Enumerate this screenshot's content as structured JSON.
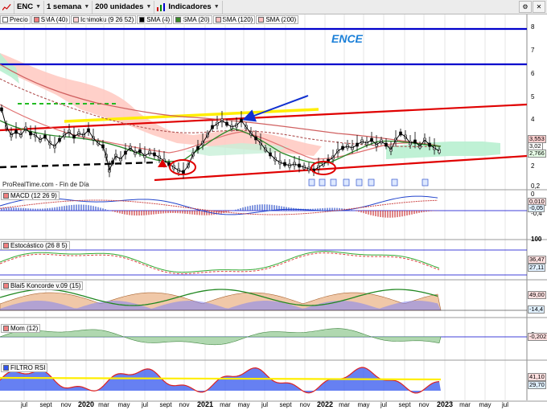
{
  "toolbar": {
    "ticker": "ENC",
    "period": "1 semana",
    "units": "200 unidades",
    "indicators": "Indicadores",
    "arrow": "▼"
  },
  "price_legend": [
    {
      "label": "Precio",
      "color": "#ffffff"
    },
    {
      "label": "SMA (40)",
      "color": "#f08080"
    },
    {
      "label": "Ichimoku (9 26 52)",
      "color": "#ffd0d0"
    },
    {
      "label": "SMA (4)",
      "color": "#000000"
    },
    {
      "label": "SMA (20)",
      "color": "#3a8a2a"
    },
    {
      "label": "SMA (120)",
      "color": "#ffc0c0"
    },
    {
      "label": "SMA (200)",
      "color": "#ffc0c0"
    }
  ],
  "annotation_title": "ENCE",
  "source_text": "ProRealTime.com - Fin de Día",
  "price_axis": [
    "8",
    "7",
    "6",
    "5",
    "4",
    "3",
    "2"
  ],
  "price_boxes": [
    "3,553",
    "3,02",
    "2,766"
  ],
  "panels": {
    "macd": {
      "label": "MACD (12 26 9)",
      "axis": [
        "0,2",
        "0",
        "-0,2",
        "-0,4"
      ],
      "boxes": [
        "0,010",
        "-0,05"
      ]
    },
    "stoch": {
      "label": "Estocástico (26 8 5)",
      "axis": [
        "100",
        "0"
      ],
      "boxes": [
        "36,47",
        "27,11"
      ]
    },
    "blai5": {
      "label": "Blai5 Koncorde v.09 (15)",
      "boxes": [
        "49,00",
        "-14,4"
      ]
    },
    "mom": {
      "label": "Mom (12)",
      "axis": [
        "0"
      ],
      "boxes": [
        "-0,202"
      ]
    },
    "rsi": {
      "label": "FILTRO RSI",
      "boxes": [
        "41,10",
        "29,70"
      ]
    }
  },
  "x_axis": [
    {
      "label": "jul",
      "year": false
    },
    {
      "label": "sept",
      "year": false
    },
    {
      "label": "nov",
      "year": false
    },
    {
      "label": "2020",
      "year": true
    },
    {
      "label": "mar",
      "year": false
    },
    {
      "label": "may",
      "year": false
    },
    {
      "label": "jul",
      "year": false
    },
    {
      "label": "sept",
      "year": false
    },
    {
      "label": "nov",
      "year": false
    },
    {
      "label": "2021",
      "year": true
    },
    {
      "label": "mar",
      "year": false
    },
    {
      "label": "may",
      "year": false
    },
    {
      "label": "jul",
      "year": false
    },
    {
      "label": "sept",
      "year": false
    },
    {
      "label": "nov",
      "year": false
    },
    {
      "label": "2022",
      "year": true
    },
    {
      "label": "mar",
      "year": false
    },
    {
      "label": "may",
      "year": false
    },
    {
      "label": "jul",
      "year": false
    },
    {
      "label": "sept",
      "year": false
    },
    {
      "label": "nov",
      "year": false
    },
    {
      "label": "2023",
      "year": true
    },
    {
      "label": "mar",
      "year": false
    },
    {
      "label": "may",
      "year": false
    },
    {
      "label": "jul",
      "year": false
    }
  ],
  "colors": {
    "trend_red": "#e00000",
    "hline_blue": "#0000cc",
    "arrow_blue": "#1030d0",
    "yellow": "#ffee00",
    "green_dash": "#22bb22",
    "kumo_red": "#ffc8c0",
    "kumo_green": "#b8f0d0"
  },
  "icons": {
    "settings": "gear-icon",
    "close": "close-icon",
    "indicators": "indicators-icon"
  }
}
